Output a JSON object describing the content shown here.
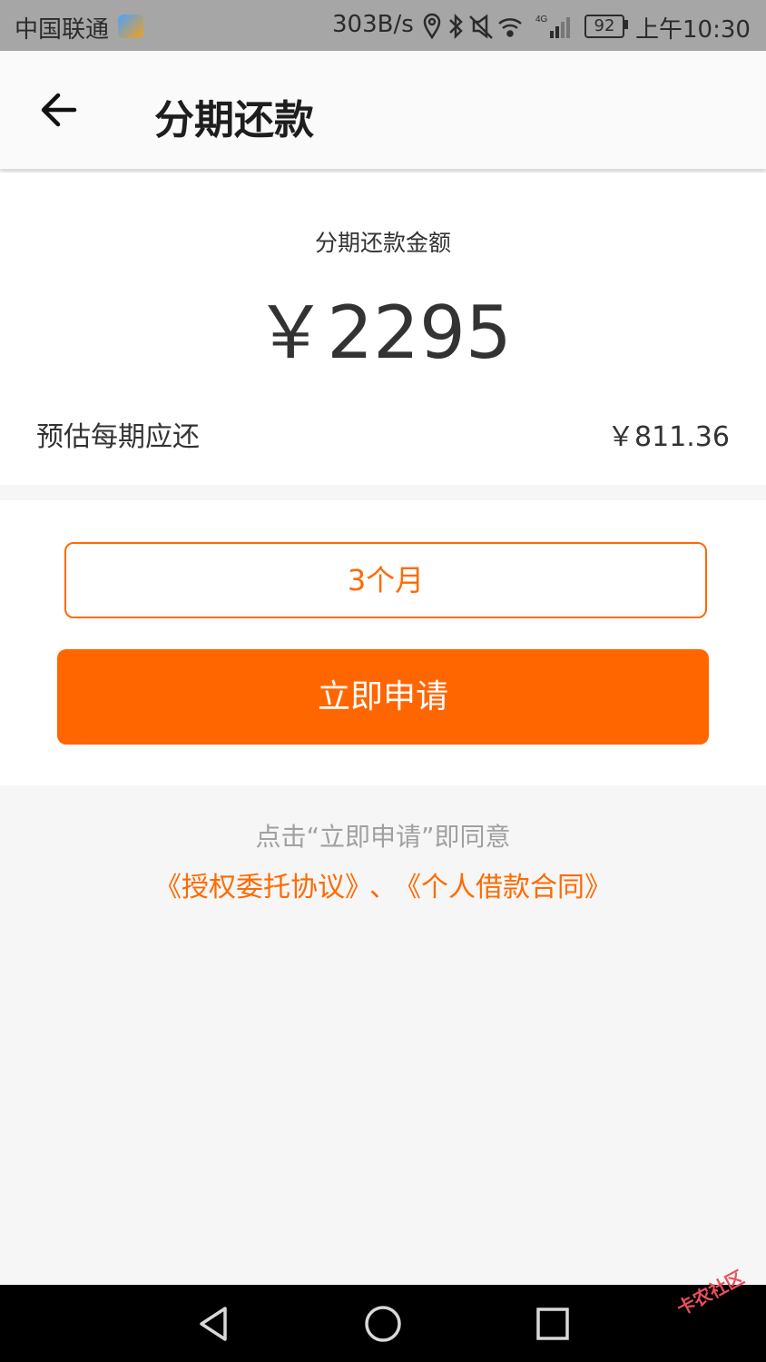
{
  "status_bar": {
    "carrier": "中国联通",
    "net_speed": "303B/s",
    "network_type": "4G",
    "battery": "92",
    "time": "上午10:30",
    "icons": [
      "location-icon",
      "bluetooth-icon",
      "mute-icon",
      "wifi-icon",
      "signal-icon",
      "battery-icon"
    ]
  },
  "header": {
    "title": "分期还款",
    "back_icon": "back-arrow-icon"
  },
  "amount": {
    "label": "分期还款金额",
    "value": "￥2295",
    "per_period_label": "预估每期应还",
    "per_period_value": "￥811.36"
  },
  "actions": {
    "term": "3个月",
    "apply_label": "立即申请"
  },
  "agreement": {
    "prefix": "点击“立即申请”即同意",
    "link1": "《授权委托协议》",
    "separator": "、",
    "link2": "《个人借款合同》"
  },
  "watermark": "卡农社区",
  "colors": {
    "accent": "#ff6600",
    "status_bar_bg": "#a6a6a6",
    "page_bg": "#f6f6f6"
  }
}
